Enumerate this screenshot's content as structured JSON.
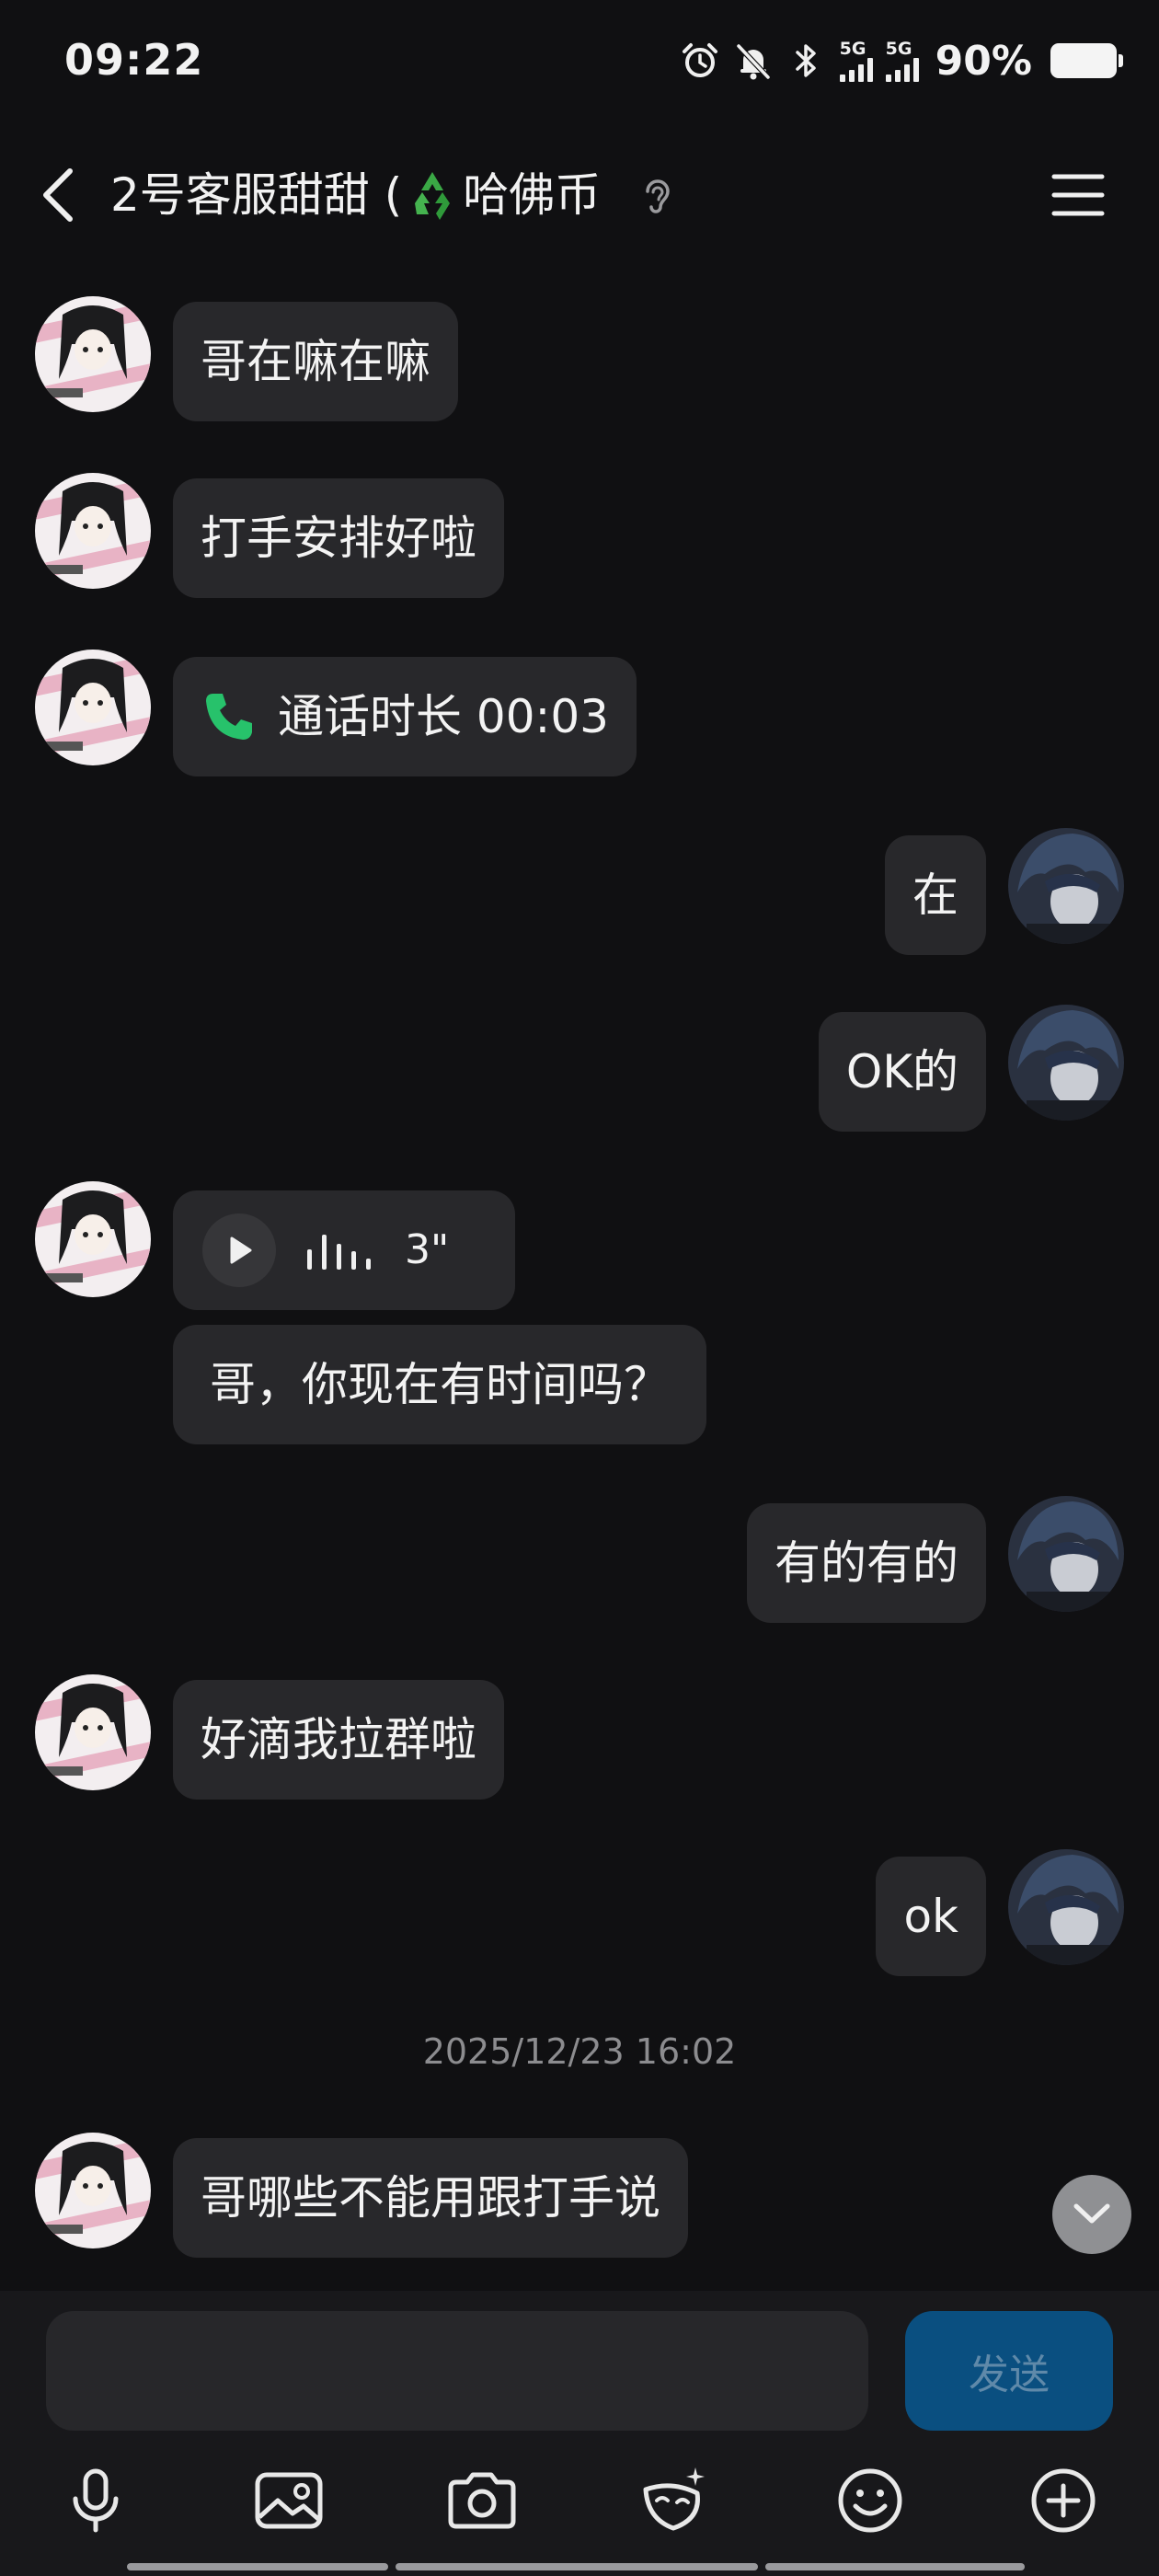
{
  "status_bar": {
    "time": "09:22",
    "network_1": "5G",
    "network_2": "5G",
    "battery": "90%",
    "icons": [
      "alarm-icon",
      "mute-bell-icon",
      "bluetooth-icon",
      "signal-icon",
      "signal-icon",
      "battery-icon"
    ]
  },
  "header": {
    "title_prefix": "2号客服甜甜 (",
    "title_emoji": "recycle-icon",
    "title_suffix": "哈佛币",
    "icons": [
      "back-icon",
      "ear-icon",
      "menu-icon"
    ]
  },
  "messages": [
    {
      "side": "left",
      "text": "哥在嘛在嘛"
    },
    {
      "side": "left",
      "text": "打手安排好啦"
    },
    {
      "side": "left",
      "type": "call",
      "text": "通话时长 00:03"
    },
    {
      "side": "right",
      "text": "在"
    },
    {
      "side": "right",
      "text": "OK的"
    },
    {
      "side": "left",
      "type": "voice",
      "duration": "3\""
    },
    {
      "side": "left",
      "text": "哥，你现在有时间吗？"
    },
    {
      "side": "right",
      "text": "有的有的"
    },
    {
      "side": "left",
      "text": "好滴我拉群啦"
    },
    {
      "side": "right",
      "text": "ok"
    },
    {
      "type": "timestamp",
      "text": "2025/12/23 16:02"
    },
    {
      "side": "left",
      "text": "哥哪些不能用跟打手说"
    }
  ],
  "input": {
    "placeholder": "",
    "value": "",
    "send_label": "发送"
  },
  "toolbar": [
    "microphone-icon",
    "image-icon",
    "camera-icon",
    "sticker-icon",
    "emoji-icon",
    "plus-icon"
  ],
  "colors": {
    "background": "#101012",
    "bubble": "#28282b",
    "send_button": "#0a4f80",
    "call_icon": "#27c26b"
  }
}
